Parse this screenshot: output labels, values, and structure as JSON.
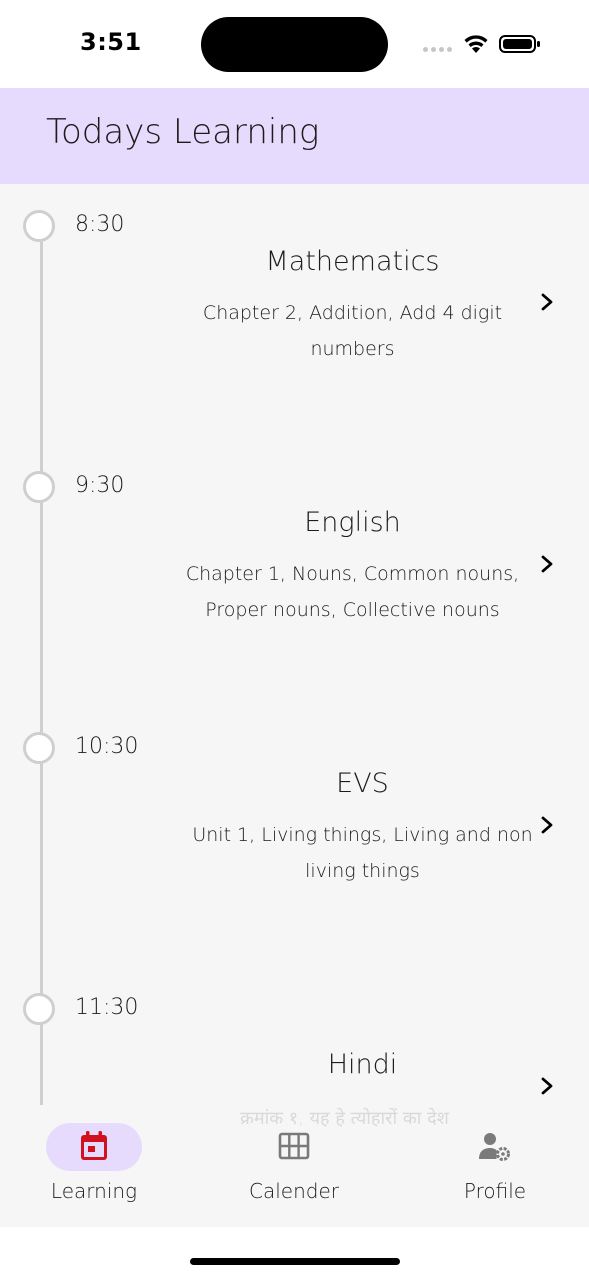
{
  "status_bar": {
    "time": "3:51"
  },
  "header": {
    "title": "Todays Learning"
  },
  "schedule": [
    {
      "time": "8:30",
      "subject": "Mathematics",
      "description": "Chapter 2, Addition, Add 4 digit numbers"
    },
    {
      "time": "9:30",
      "subject": "English",
      "description": "Chapter 1, Nouns, Common nouns, Proper nouns, Collective nouns"
    },
    {
      "time": "10:30",
      "subject": "EVS",
      "description": "Unit 1, Living things, Living and non living things"
    },
    {
      "time": "11:30",
      "subject": "Hindi",
      "description": "क्रमांक १, यह हे त्योहारों का देश"
    }
  ],
  "bottom_nav": [
    {
      "label": "Learning",
      "icon": "calendar-icon",
      "active": true
    },
    {
      "label": "Calender",
      "icon": "grid-icon",
      "active": false
    },
    {
      "label": "Profile",
      "icon": "user-settings-icon",
      "active": false
    }
  ],
  "colors": {
    "header_bg": "#e7dbfd",
    "active_icon": "#d0121e",
    "content_bg": "#f6f6f6"
  }
}
